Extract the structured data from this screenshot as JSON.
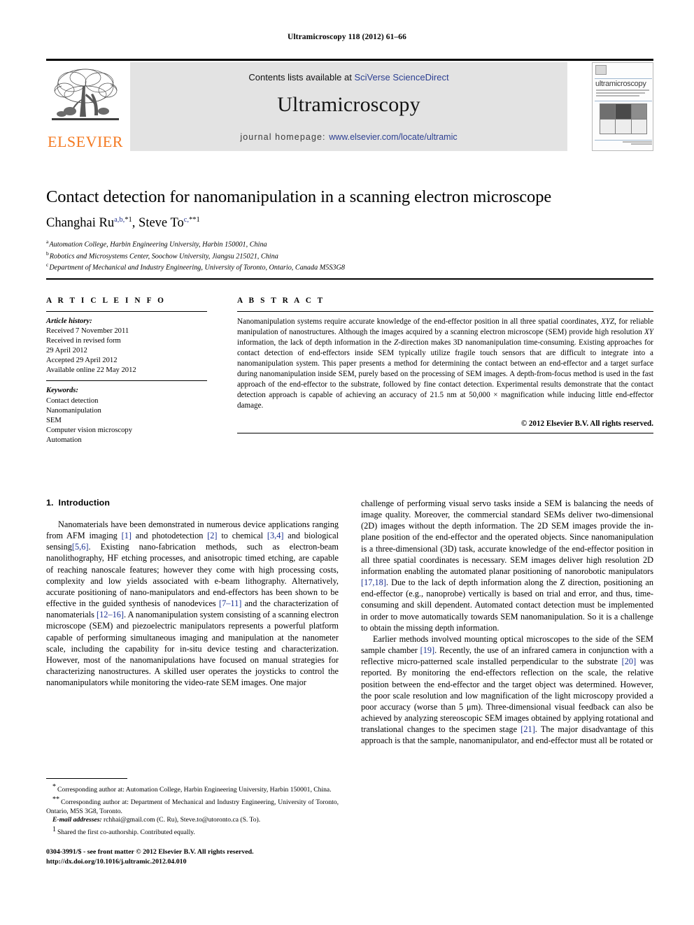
{
  "running_head": "Ultramicroscopy 118 (2012) 61–66",
  "masthead": {
    "contents_prefix": "Contents lists available at ",
    "contents_link": "SciVerse ScienceDirect",
    "journal_title": "Ultramicroscopy",
    "homepage_label": "journal homepage: ",
    "homepage_url": "www.elsevier.com/locate/ultramic",
    "publisher_logo_word": "ELSEVIER",
    "publisher_accent_color": "#f47920",
    "link_color": "#2c3f91",
    "band_color": "#e3e3e3"
  },
  "cover": {
    "title": "ultramicroscopy"
  },
  "title_block": {
    "title": "Contact detection for nanomanipulation in a scanning electron microscope",
    "authors": [
      {
        "name": "Changhai Ru",
        "marks": "a,b,",
        "symbol": "*",
        "footnote": "1"
      },
      {
        "name": "Steve To",
        "marks": "c,",
        "symbol": "**",
        "footnote": "1"
      }
    ],
    "author_separator": ", ",
    "affiliations": [
      {
        "mark": "a",
        "text": "Automation College, Harbin Engineering University, Harbin 150001, China"
      },
      {
        "mark": "b",
        "text": "Robotics and Microsystems Center, Soochow University, Jiangsu 215021, China"
      },
      {
        "mark": "c",
        "text": "Department of Mechanical and Industry Engineering, University of Toronto, Ontario, Canada M5S3G8"
      }
    ]
  },
  "article_info": {
    "heading": "A R T I C L E   I N F O",
    "history_label": "Article history:",
    "history": [
      "Received 7 November 2011",
      "Received in revised form",
      "29 April 2012",
      "Accepted 29 April 2012",
      "Available online 22 May 2012"
    ],
    "keywords_label": "Keywords:",
    "keywords": [
      "Contact detection",
      "Nanomanipulation",
      "SEM",
      "Computer vision microscopy",
      "Automation"
    ]
  },
  "abstract": {
    "heading": "A B S T R A C T",
    "p1": "Nanomanipulation systems require accurate knowledge of the end-effector position in all three spatial coordinates, ",
    "xyz": "XYZ",
    "p2": ", for reliable manipulation of nanostructures. Although the images acquired by a scanning electron microscope (SEM) provide high resolution ",
    "xy": "XY",
    "p3": " information, the lack of depth information in the ",
    "zdir": "Z",
    "p4": "-direction makes 3D nanomanipulation time-consuming. Existing approaches for contact detection of end-effectors inside SEM typically utilize fragile touch sensors that are difficult to integrate into a nanomanipulation system. This paper presents a method for determining the contact between an end-effector and a target surface during nanomanipulation inside SEM, purely based on the processing of SEM images. A depth-from-focus method is used in the fast approach of the end-effector to the substrate, followed by fine contact detection. Experimental results demonstrate that the contact detection approach is capable of achieving an accuracy of 21.5 nm at 50,000 ×  magnification while inducing little end-effector damage.",
    "copyright": "© 2012 Elsevier B.V. All rights reserved."
  },
  "introduction": {
    "number": "1.",
    "heading": "Introduction"
  },
  "left_column": {
    "p1_a": "Nanomaterials have been demonstrated in numerous device applications ranging from AFM imaging ",
    "r1": "[1]",
    "p1_b": " and photodetection ",
    "r2": "[2]",
    "p1_c": " to chemical ",
    "r3": "[3,4]",
    "p1_d": " and biological sensing",
    "r4": "[5,6]",
    "p1_e": ". Existing nano-fabrication methods, such as electron-beam nanolithography, HF etching processes, and anisotropic timed etching, are capable of reaching nanoscale features; however they come with high processing costs, complexity and low yields associated with e-beam lithography. Alternatively, accurate positioning of nano-manipulators and end-effectors has been shown to be effective in the guided synthesis of nanodevices ",
    "r5": "[7–11]",
    "p1_f": " and the characterization of nanomaterials ",
    "r6": "[12–16]",
    "p1_g": ". A nanomanipulation system consisting of a scanning electron microscope (SEM) and piezoelectric manipulators represents a powerful platform capable of performing simultaneous imaging and manipulation at the nanometer scale, including the capability for in-situ device testing and characterization. However, most of the nanomanipulations have focused on manual strategies for characterizing nanostructures. A skilled user operates the joysticks to control the nanomanipulators while monitoring the video-rate SEM images. One major"
  },
  "right_column": {
    "p1_a": "challenge of performing visual servo tasks inside a SEM is balancing the needs of image quality. Moreover, the commercial standard SEMs deliver two-dimensional (2D) images without the depth information. The 2D SEM images provide the in-plane position of the end-effector and the operated objects. Since nanomanipulation is a three-dimensional (3D) task, accurate knowledge of the end-effector position in all three spatial coordinates is necessary. SEM images deliver high resolution 2D information enabling the automated planar positioning of nanorobotic manipulators ",
    "r17": "[17,18]",
    "p1_b": ". Due to the lack of depth information along the Z direction, positioning an end-effector (e.g., nanoprobe) vertically is based on trial and error, and thus, time-consuming and skill dependent. Automated contact detection must be implemented in order to move automatically towards SEM nanomanipulation. So it is a challenge to obtain the missing depth information.",
    "p2_a": "Earlier methods involved mounting optical microscopes to the side of the SEM sample chamber ",
    "r19": "[19]",
    "p2_b": ". Recently, the use of an infrared camera in conjunction with a reflective micro-patterned scale installed perpendicular to the substrate ",
    "r20": "[20]",
    "p2_c": " was reported. By monitoring the end-effectors reflection on the scale, the relative position between the end-effector and the target object was determined. However, the poor scale resolution and low magnification of the light microscopy provided a poor accuracy (worse than 5 μm). Three-dimensional visual feedback can also be achieved by analyzing stereoscopic SEM images obtained by applying rotational and translational changes to the specimen stage ",
    "r21": "[21]",
    "p2_d": ". The major disadvantage of this approach is that the sample, nanomanipulator, and end-effector must all be rotated or"
  },
  "footnotes": {
    "fn1_mark": "*",
    "fn1": "Corresponding author at: Automation College, Harbin Engineering University, Harbin 150001, China.",
    "fn2_mark": "**",
    "fn2": "Corresponding author at: Department of Mechanical and Industry Engineering, University of Toronto, Ontario, M5S 3G8, Toronto.",
    "fn3_label": "E-mail addresses:",
    "fn3": " rchhai@gmail.com (C. Ru), Steve.to@utoronto.ca (S. To).",
    "fn4_mark": "1",
    "fn4": "Shared the first co-authorship. Contributed equally."
  },
  "imprint": {
    "line1": "0304-3991/$ - see front matter © 2012 Elsevier B.V. All rights reserved.",
    "line2": "http://dx.doi.org/10.1016/j.ultramic.2012.04.010"
  }
}
